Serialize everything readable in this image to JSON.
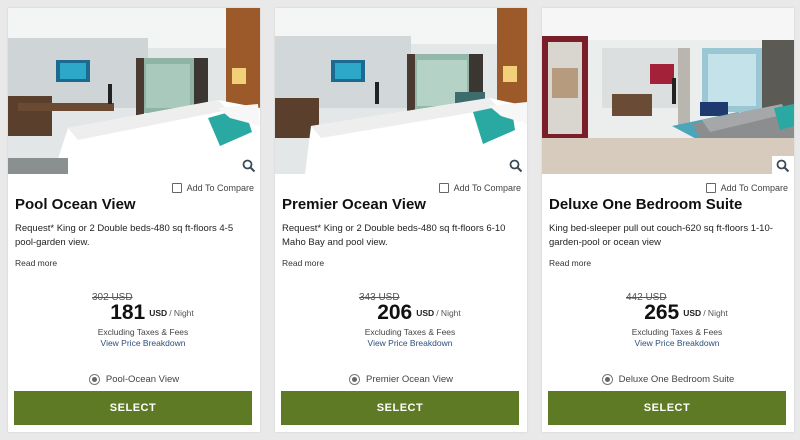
{
  "colors": {
    "select_button": "#5e7a24",
    "link": "#2d4f7a",
    "page_bg": "#e9e9e9"
  },
  "rooms": [
    {
      "name": "Pool Ocean View",
      "compare_label": "Add To Compare",
      "description": "Request* King or 2 Double beds-480 sq ft-floors 4-5 pool-garden view.",
      "read_more": "Read more",
      "old_price": "302 USD",
      "price": "181",
      "currency": "USD",
      "per": "/ Night",
      "taxes": "Excluding Taxes & Fees",
      "breakdown": "View Price Breakdown",
      "rate_option": "Pool-Ocean View",
      "select_label": "SELECT",
      "zoom_icon": "search-icon"
    },
    {
      "name": "Premier Ocean View",
      "compare_label": "Add To Compare",
      "description": "Request* King or 2 Double beds-480 sq ft-floors 6-10 Maho Bay and pool view.",
      "read_more": "Read more",
      "old_price": "343 USD",
      "price": "206",
      "currency": "USD",
      "per": "/ Night",
      "taxes": "Excluding Taxes & Fees",
      "breakdown": "View Price Breakdown",
      "rate_option": "Premier Ocean View",
      "select_label": "SELECT",
      "zoom_icon": "search-icon"
    },
    {
      "name": "Deluxe One Bedroom Suite",
      "compare_label": "Add To Compare",
      "description": "King bed-sleeper pull out couch-620 sq ft-floors 1-10-garden-pool or ocean view",
      "read_more": "Read more",
      "old_price": "442 USD",
      "price": "265",
      "currency": "USD",
      "per": "/ Night",
      "taxes": "Excluding Taxes & Fees",
      "breakdown": "View Price Breakdown",
      "rate_option": "Deluxe One Bedroom Suite",
      "select_label": "SELECT",
      "zoom_icon": "search-icon"
    }
  ]
}
